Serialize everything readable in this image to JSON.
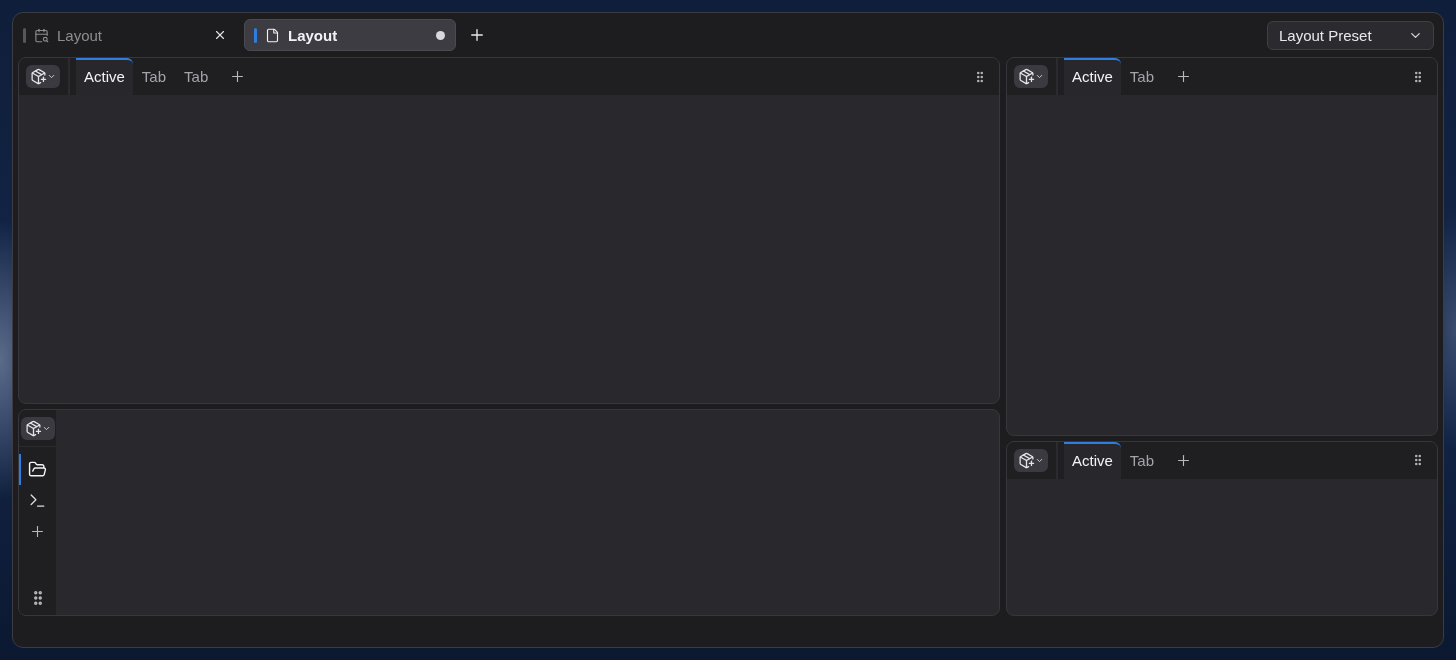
{
  "window_tabs": [
    {
      "kind": "calendar",
      "label": "Layout",
      "selected": false,
      "modified": false
    },
    {
      "kind": "document",
      "label": "Layout",
      "selected": true,
      "modified": true
    }
  ],
  "preset_dropdown": {
    "label": "Layout Preset"
  },
  "columns": [
    {
      "panels": [
        {
          "kind": "tabbed",
          "tabs": [
            {
              "label": "Active",
              "selected": true
            },
            {
              "label": "Tab",
              "selected": false
            },
            {
              "label": "Tab",
              "selected": false
            }
          ]
        },
        {
          "kind": "sidebar",
          "sidebar_items": [
            {
              "kind": "folder",
              "selected": true
            },
            {
              "kind": "terminal",
              "selected": false
            }
          ]
        }
      ]
    },
    {
      "panels": [
        {
          "kind": "tabbed",
          "tabs": [
            {
              "label": "Active",
              "selected": true
            },
            {
              "label": "Tab",
              "selected": false
            }
          ]
        },
        {
          "kind": "tabbed",
          "tabs": [
            {
              "label": "Active",
              "selected": true
            },
            {
              "label": "Tab",
              "selected": false
            }
          ]
        }
      ]
    }
  ]
}
